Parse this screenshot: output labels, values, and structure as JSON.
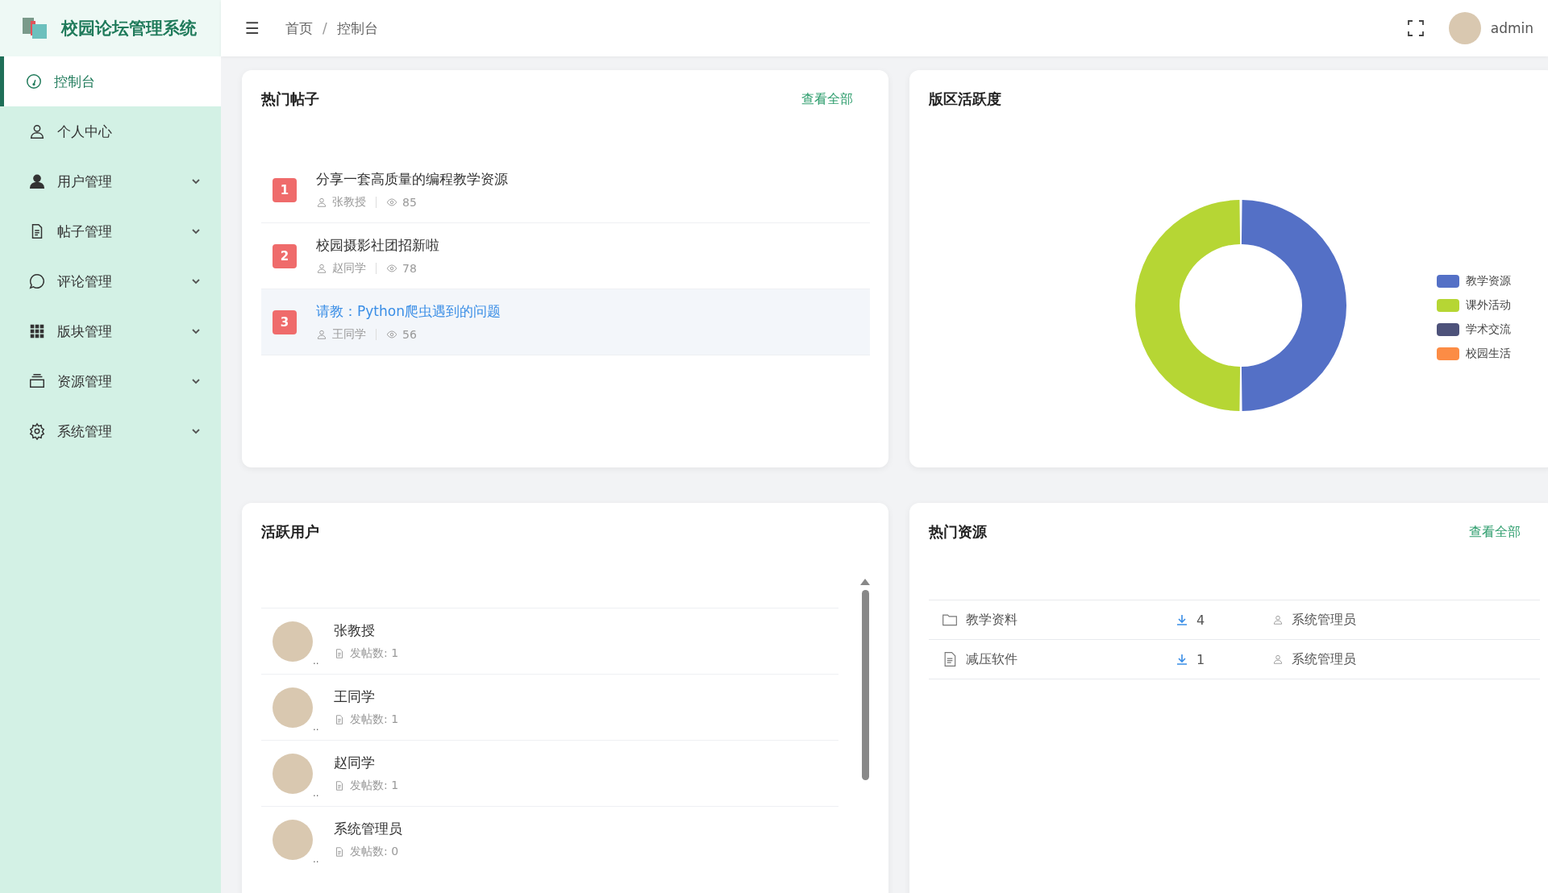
{
  "app": {
    "title": "校园论坛管理系统"
  },
  "sidebar": {
    "items": [
      {
        "label": "控制台",
        "selected": true,
        "expandable": false
      },
      {
        "label": "个人中心",
        "selected": false,
        "expandable": false
      },
      {
        "label": "用户管理",
        "selected": false,
        "expandable": true
      },
      {
        "label": "帖子管理",
        "selected": false,
        "expandable": true
      },
      {
        "label": "评论管理",
        "selected": false,
        "expandable": true
      },
      {
        "label": "版块管理",
        "selected": false,
        "expandable": true
      },
      {
        "label": "资源管理",
        "selected": false,
        "expandable": true
      },
      {
        "label": "系统管理",
        "selected": false,
        "expandable": true
      }
    ]
  },
  "header": {
    "menu_icon": "☰",
    "breadcrumb": [
      "首页",
      "控制台"
    ],
    "breadcrumb_separator": "/",
    "user": "admin"
  },
  "hot_posts": {
    "title": "热门帖子",
    "link": "查看全部",
    "items": [
      {
        "rank": "1",
        "title": "分享一套高质量的编程教学资源",
        "author": "张教授",
        "views": "85",
        "selected": false
      },
      {
        "rank": "2",
        "title": "校园摄影社团招新啦",
        "author": "赵同学",
        "views": "78",
        "selected": false
      },
      {
        "rank": "3",
        "title": "请教：Python爬虫遇到的问题",
        "author": "王同学",
        "views": "56",
        "selected": true
      }
    ]
  },
  "activity": {
    "chart_data": {
      "type": "donut",
      "title": "版区活跃度",
      "categories": [
        "教学资源",
        "课外活动",
        "学术交流",
        "校园生活"
      ],
      "values": [
        50,
        50,
        0,
        0
      ],
      "colors": [
        "#5470c6",
        "#b6d634",
        "#4d527a",
        "#fc8c45"
      ]
    }
  },
  "active_users": {
    "title": "活跃用户",
    "items": [
      {
        "name": "张教授",
        "mark": "..",
        "posts": "发帖数: 1"
      },
      {
        "name": "王同学",
        "mark": "..",
        "posts": "发帖数: 1"
      },
      {
        "name": "赵同学",
        "mark": "..",
        "posts": "发帖数: 1"
      },
      {
        "name": "系统管理员",
        "mark": "..",
        "posts": "发帖数: 0"
      }
    ]
  },
  "hot_resources": {
    "title": "热门资源",
    "link": "查看全部",
    "rows": [
      {
        "kind": "folder",
        "name": "教学资料",
        "downloads": "4",
        "uploader": "系统管理员"
      },
      {
        "kind": "file",
        "name": "减压软件",
        "downloads": "1",
        "uploader": "系统管理员"
      }
    ]
  }
}
